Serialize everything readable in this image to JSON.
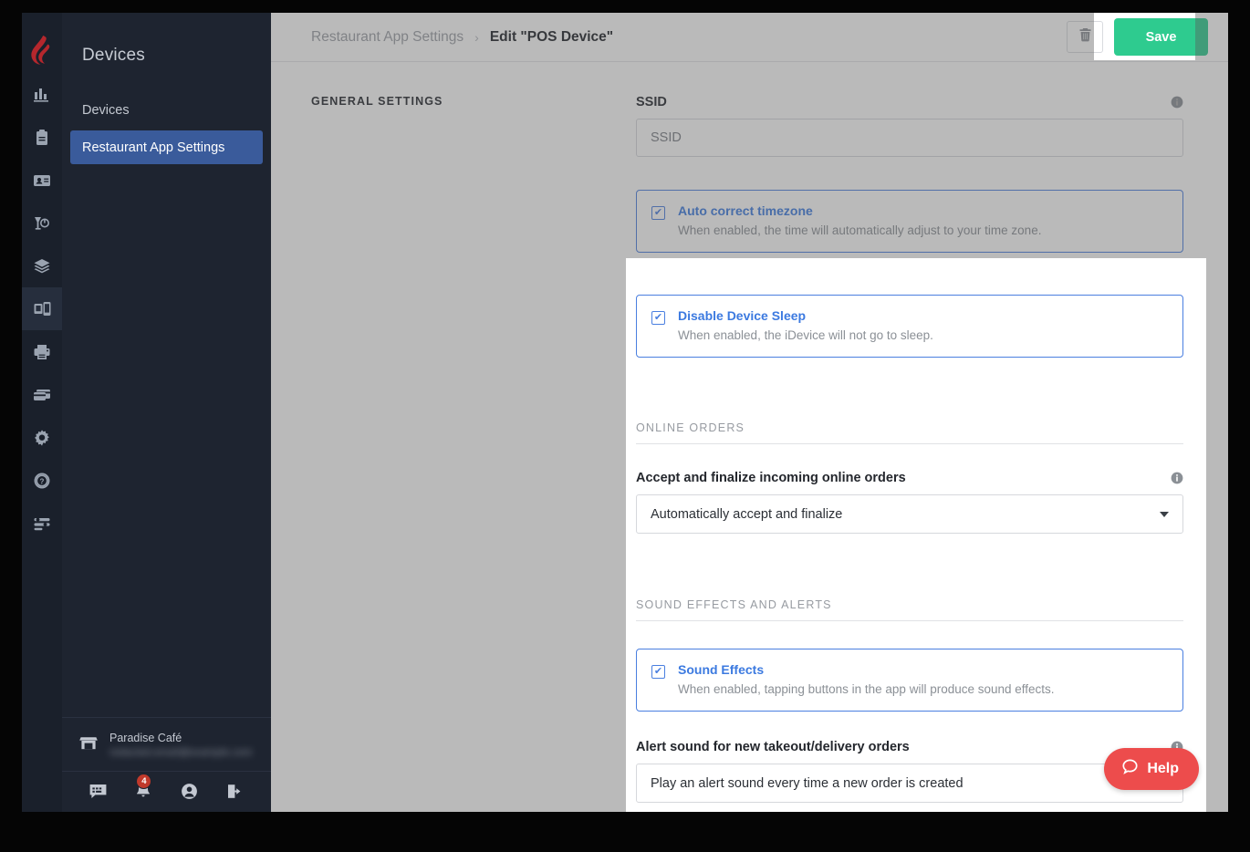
{
  "brand": {
    "logo_icon": "lightspeed-flame-logo",
    "accent_red": "#b5272d"
  },
  "sidebar": {
    "title": "Devices",
    "rail_icons": [
      {
        "name": "reports-icon"
      },
      {
        "name": "clipboard-icon"
      },
      {
        "name": "customers-icon"
      },
      {
        "name": "drinks-icon"
      },
      {
        "name": "layers-icon"
      },
      {
        "name": "devices-icon"
      },
      {
        "name": "printer-icon"
      },
      {
        "name": "payments-icon"
      },
      {
        "name": "gear-icon"
      },
      {
        "name": "help-circle-icon"
      },
      {
        "name": "list-settings-icon"
      }
    ],
    "items": [
      {
        "label": "Devices",
        "active": false
      },
      {
        "label": "Restaurant App Settings",
        "active": true
      }
    ],
    "store": {
      "icon": "store-icon",
      "name": "Paradise Café",
      "email": "redacted.email@example.com"
    },
    "actions": [
      {
        "name": "messages-icon",
        "label": ""
      },
      {
        "name": "notifications-bell-icon",
        "label": "",
        "badge": "4"
      },
      {
        "name": "account-icon",
        "label": ""
      },
      {
        "name": "logout-icon",
        "label": ""
      }
    ]
  },
  "topbar": {
    "breadcrumb_parent": "Restaurant App Settings",
    "breadcrumb_separator": "›",
    "breadcrumb_current": "Edit \"POS Device\"",
    "delete_icon": "trash-icon",
    "save_label": "Save",
    "save_color": "#2ecb8f"
  },
  "content": {
    "left_section_title": "GENERAL SETTINGS",
    "ssid": {
      "label": "SSID",
      "placeholder": "SSID",
      "value": "",
      "info_icon": "info-icon"
    },
    "auto_timezone": {
      "title": "Auto correct timezone",
      "description": "When enabled, the time will automatically adjust to your time zone.",
      "checked": true
    },
    "disable_sleep": {
      "title": "Disable Device Sleep",
      "description": "When enabled, the iDevice will not go to sleep.",
      "checked": true
    },
    "online_orders": {
      "group_header": "ONLINE ORDERS",
      "field_label": "Accept and finalize incoming online orders",
      "selected": "Automatically accept and finalize",
      "info_icon": "info-icon"
    },
    "sound_effects_group": {
      "group_header": "SOUND EFFECTS AND ALERTS",
      "sound_effects": {
        "title": "Sound Effects",
        "description": "When enabled, tapping buttons in the app will produce sound effects.",
        "checked": true
      },
      "alert_sound": {
        "field_label": "Alert sound for new takeout/delivery orders",
        "selected": "Play an alert sound every time a new order is created",
        "info_icon": "info-icon"
      }
    }
  },
  "help_widget": {
    "label": "Help",
    "icon": "chat-bubble-icon",
    "color": "#ed4c4c"
  },
  "checkmark_glyph": "✔"
}
